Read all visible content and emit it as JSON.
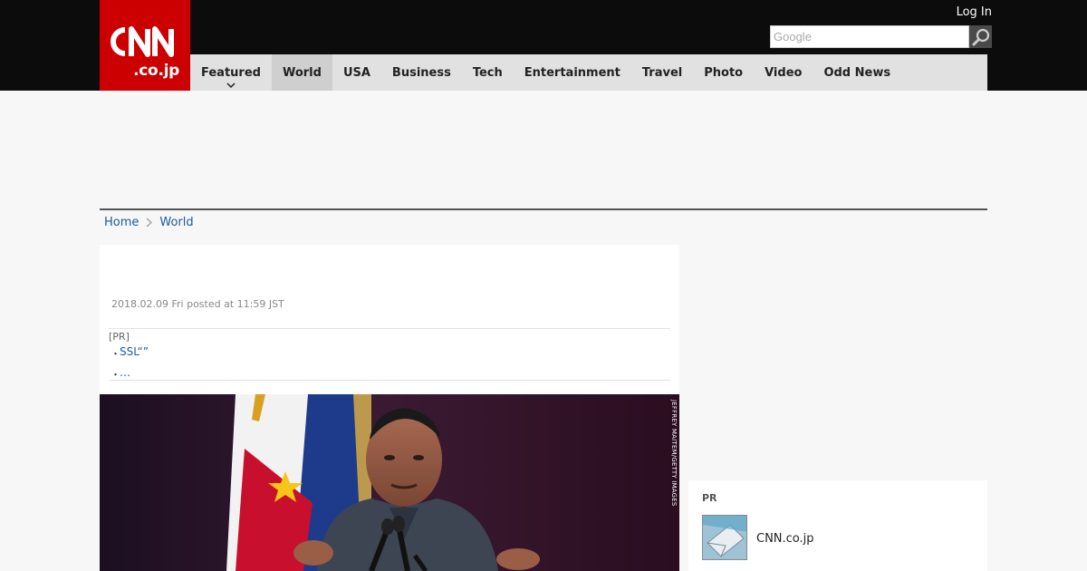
{
  "header": {
    "logo_main": "CNN",
    "logo_sub": ".co.jp",
    "login_label": "Log In",
    "search_placeholder": "Google"
  },
  "nav": {
    "items": [
      {
        "label": "Featured"
      },
      {
        "label": "World"
      },
      {
        "label": "USA"
      },
      {
        "label": "Business"
      },
      {
        "label": "Tech"
      },
      {
        "label": "Entertainment"
      },
      {
        "label": "Travel"
      },
      {
        "label": "Photo"
      },
      {
        "label": "Video"
      },
      {
        "label": "Odd News"
      }
    ],
    "active": "World"
  },
  "breadcrumb": {
    "home": "Home",
    "current": "World"
  },
  "article": {
    "date": "2018.02.09 Fri posted at 11:59 JST",
    "pr_tag": "[PR]",
    "pr_links": [
      "SSL“”",
      "…"
    ],
    "pr_bullet": "・",
    "photo_credit": "JEFFREY MAITEM/GETTY IMAGES"
  },
  "sidebar_pr": {
    "title": "PR",
    "item_label": "CNN.co.jp"
  },
  "colors": {
    "brand_red": "#cc0000",
    "link_blue": "#1a5aa6",
    "nav_bg": "#e1e1e1",
    "topbar_bg": "#0c0c0c"
  }
}
